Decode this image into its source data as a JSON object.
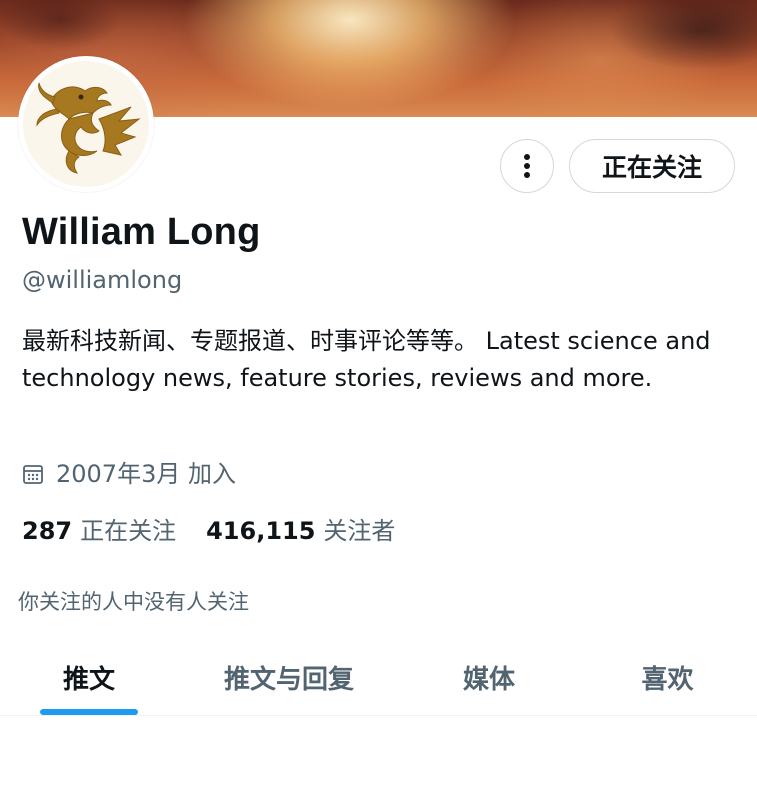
{
  "profile": {
    "name": "William Long",
    "handle": "@williamlong",
    "bio": "最新科技新闻、专题报道、时事评论等等。 Latest science and technology news, feature stories, reviews and more.",
    "joined": "2007年3月 加入",
    "following_count": "287",
    "following_label": "正在关注",
    "followers_count": "416,115",
    "followers_label": "关注者",
    "mutual_note": "你关注的人中没有人关注"
  },
  "actions": {
    "more_icon": "more-vertical-icon",
    "follow_label": "正在关注"
  },
  "tabs": [
    {
      "label": "推文",
      "active": true
    },
    {
      "label": "推文与回复",
      "active": false
    },
    {
      "label": "媒体",
      "active": false
    },
    {
      "label": "喜欢",
      "active": false
    }
  ],
  "icons": {
    "calendar": "calendar-icon",
    "avatar": "dragon-logo"
  },
  "colors": {
    "accent": "#1d9bf0",
    "text_primary": "#0f1419",
    "text_secondary": "#536471",
    "border": "#cfd9de",
    "avatar_gold": "#a67820"
  }
}
